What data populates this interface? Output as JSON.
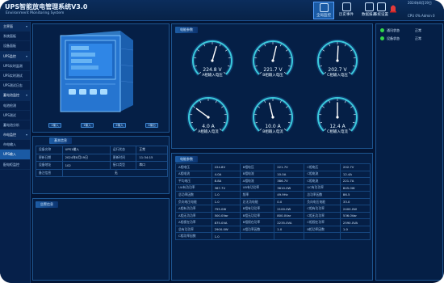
{
  "header": {
    "title": "UPS智能放电管理系统V3.0",
    "subtitle": "Environment Monitoring System",
    "datetime": "2024年8月19日",
    "user": "CPU 0%  Admin 0",
    "nav": [
      {
        "label": "全局监控",
        "icon": "monitor-icon"
      },
      {
        "label": "历史事件",
        "icon": "history-icon"
      },
      {
        "label": "数据报表",
        "icon": "report-icon"
      },
      {
        "label": "系统设置",
        "icon": "settings-icon"
      }
    ]
  },
  "sidebar": {
    "items": [
      {
        "label": "主界面",
        "type": "group"
      },
      {
        "label": "系统面板",
        "type": "item"
      },
      {
        "label": "设备面板",
        "type": "item"
      },
      {
        "label": "UPS监控",
        "type": "group"
      },
      {
        "label": "UPS实时监测",
        "type": "item"
      },
      {
        "label": "UPS实时测试",
        "type": "item"
      },
      {
        "label": "UPS测试日志",
        "type": "item"
      },
      {
        "label": "蓄电池监控",
        "type": "group"
      },
      {
        "label": "电池检测",
        "type": "item"
      },
      {
        "label": "UPS测试",
        "type": "item"
      },
      {
        "label": "蓄电池分析",
        "type": "item"
      },
      {
        "label": "市电监控",
        "type": "group"
      },
      {
        "label": "市电输入",
        "type": "item"
      },
      {
        "label": "UPS输入",
        "type": "item"
      },
      {
        "label": "配电柜监控",
        "type": "item"
      }
    ]
  },
  "device": {
    "tags": [
      "1输入",
      "1输入",
      "2输入",
      "1输出"
    ]
  },
  "info": {
    "title": "基本信息",
    "rows": [
      [
        "设备名称",
        "UPS1输入",
        "运行状态",
        "正常"
      ],
      [
        "更新日期",
        "2024年8月19日",
        "更新时间",
        "11:34:15"
      ],
      [
        "设备地址",
        "102",
        "接口类型",
        "串口"
      ],
      [
        "备注信息",
        "无",
        "",
        ""
      ]
    ]
  },
  "empty_panel": {
    "title": "告警信息"
  },
  "gauges": {
    "title": "电能参数",
    "items": [
      {
        "value": "224.8 V",
        "label": "A相输入电压",
        "fraction": 0.56
      },
      {
        "value": "221.7 V",
        "label": "B相输入电压",
        "fraction": 0.55
      },
      {
        "value": "202.7 V",
        "label": "C相输入电压",
        "fraction": 0.51
      },
      {
        "value": "4.0 A",
        "label": "A相输入电流",
        "fraction": 0.3
      },
      {
        "value": "10.0 A",
        "label": "B相输入电流",
        "fraction": 0.45
      },
      {
        "value": "12.4 A",
        "label": "C相输入电流",
        "fraction": 0.5
      }
    ],
    "colors": {
      "ring": "#3fd8e8",
      "track": "#0f3d6e",
      "text": "#e8f6ff"
    }
  },
  "electric": {
    "title": "电能参数",
    "rows": [
      [
        "A相电压",
        "224.8V",
        "B相电压",
        "221.7V",
        "C相电压",
        "202.7V"
      ],
      [
        "A相电流",
        "4.0A",
        "B相电流",
        "10.0A",
        "C相电流",
        "12.4A"
      ],
      [
        "平均电压",
        "8.8A",
        "A相电流",
        "386.7V",
        "C相电流",
        "221.7A"
      ],
      [
        "UA有功功率",
        "367.7V",
        "UB有功功率",
        "3610.0W",
        "UC有功功率",
        "845.0W"
      ],
      [
        "总功率因数",
        "1.0",
        "频率",
        "49.9Hz",
        "总功率因数",
        "86.5"
      ],
      [
        "负向电压电能",
        "1.0",
        "总无功电能",
        "0.0",
        "负向电压电能",
        "33.0"
      ],
      [
        "A相有功功率",
        "755.0W",
        "B相有功功率",
        "2100.0W",
        "C相有功功率",
        "2400.0W"
      ],
      [
        "A相无功功率",
        "500.0Var",
        "B相无功功率",
        "800.0Var",
        "C相无功功率",
        "536.0Var"
      ],
      [
        "A相视在功率",
        "875.0VA",
        "B相视在功率",
        "2235.0VA",
        "C相视在功率",
        "2590.0VA"
      ],
      [
        "总有功功率",
        "2900.0W",
        "A相功率因数",
        "1.0",
        "B相功率因数",
        "1.0"
      ],
      [
        "C相功率因数",
        "1.0",
        "",
        "",
        "",
        ""
      ]
    ]
  },
  "status": {
    "items": [
      {
        "label": "通讯状态",
        "value": "正常",
        "color": "#32d64a"
      },
      {
        "label": "设备状态",
        "value": "正常",
        "color": "#32d64a"
      }
    ]
  }
}
